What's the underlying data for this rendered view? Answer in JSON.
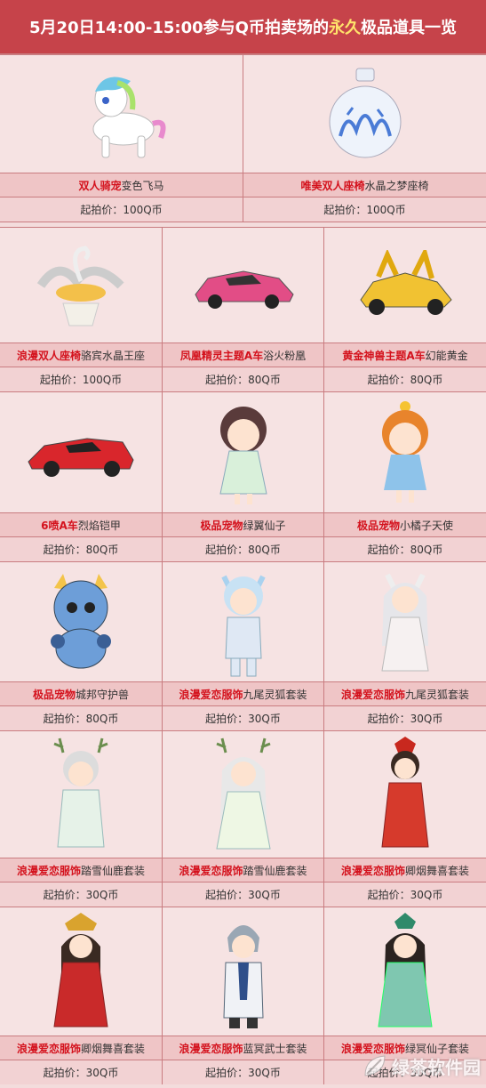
{
  "header": {
    "part1": "5月20日14:00-15:00",
    "part2": "参与Q币拍卖场的",
    "part3": "永久",
    "part4": "极品道具一览"
  },
  "rows": [
    {
      "items": [
        {
          "cat": "双人骑宠",
          "name": "变色飞马",
          "price": "起拍价：100Q币",
          "icon": "pony-icon"
        },
        {
          "cat": "唯美双人座椅",
          "name": "水晶之梦座椅",
          "price": "起拍价：100Q币",
          "icon": "crystal-bottle-icon"
        }
      ]
    },
    {
      "items": [
        {
          "cat": "浪漫双人座椅",
          "name": "骆宾水晶王座",
          "price": "起拍价：100Q币",
          "icon": "swan-throne-icon"
        },
        {
          "cat": "凤凰精灵主题A车",
          "name": "浴火粉凰",
          "price": "起拍价：80Q币",
          "icon": "pink-car-icon"
        },
        {
          "cat": "黄金神兽主题A车",
          "name": "幻能黄金",
          "price": "起拍价：80Q币",
          "icon": "gold-car-icon"
        }
      ]
    },
    {
      "items": [
        {
          "cat": "6喷A车",
          "name": "烈焰铠甲",
          "price": "起拍价：80Q币",
          "icon": "red-car-icon"
        },
        {
          "cat": "极品宠物",
          "name": "绿翼仙子",
          "price": "起拍价：80Q币",
          "icon": "green-fairy-icon"
        },
        {
          "cat": "极品宠物",
          "name": "小橘子天使",
          "price": "起拍价：80Q币",
          "icon": "orange-angel-icon"
        }
      ]
    },
    {
      "items": [
        {
          "cat": "极品宠物",
          "name": "城邦守护兽",
          "price": "起拍价：80Q币",
          "icon": "blue-dragon-icon"
        },
        {
          "cat": "浪漫爱恋服饰",
          "name": "九尾灵狐套装",
          "price": "起拍价：30Q币",
          "icon": "fox-boy-icon"
        },
        {
          "cat": "浪漫爱恋服饰",
          "name": "九尾灵狐套装",
          "price": "起拍价：30Q币",
          "icon": "fox-girl-icon"
        }
      ]
    },
    {
      "items": [
        {
          "cat": "浪漫爱恋服饰",
          "name": "踏雪仙鹿套装",
          "price": "起拍价：30Q币",
          "icon": "deer-boy-icon"
        },
        {
          "cat": "浪漫爱恋服饰",
          "name": "踏雪仙鹿套装",
          "price": "起拍价：30Q币",
          "icon": "deer-girl-icon"
        },
        {
          "cat": "浪漫爱恋服饰",
          "name": "卿烟舞喜套装",
          "price": "起拍价：30Q币",
          "icon": "red-robe-boy-icon"
        }
      ]
    },
    {
      "items": [
        {
          "cat": "浪漫爱恋服饰",
          "name": "卿烟舞喜套装",
          "price": "起拍价：30Q币",
          "icon": "red-robe-girl-icon"
        },
        {
          "cat": "浪漫爱恋服饰",
          "name": "蓝冥武士套装",
          "price": "起拍价：30Q币",
          "icon": "blue-warrior-icon"
        },
        {
          "cat": "浪漫爱恋服饰",
          "name": "绿冥仙子套装",
          "price": "起拍价：30Q币",
          "icon": "green-lady-icon"
        }
      ]
    }
  ],
  "watermark": "绿茶软件园",
  "colors": {
    "header_bg": "#c6434a",
    "highlight": "#ffe36b",
    "category_red": "#d4121d"
  }
}
